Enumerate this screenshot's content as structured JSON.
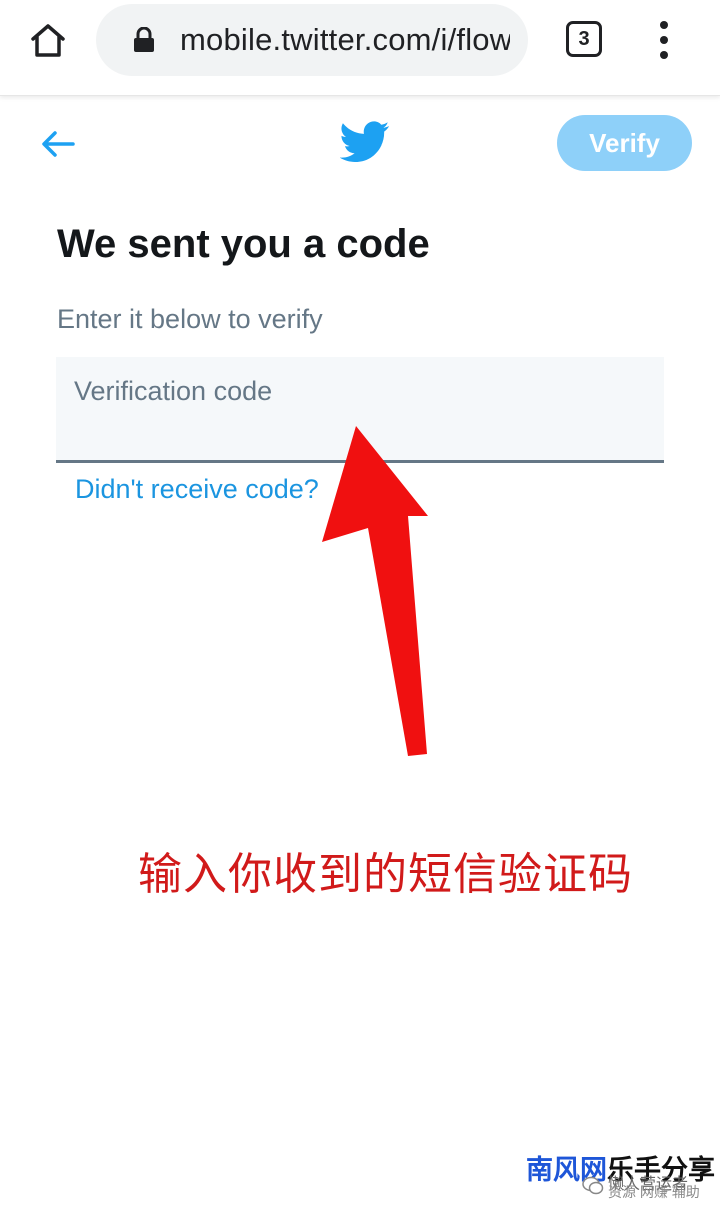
{
  "browser": {
    "url": "mobile.twitter.com/i/flow/login",
    "tab_count": "3"
  },
  "header": {
    "verify_label": "Verify"
  },
  "content": {
    "title": "We sent you a code",
    "subtitle": "Enter it below to verify",
    "code_placeholder": "Verification code",
    "resend_link": "Didn't receive code?"
  },
  "annotation": {
    "text": "输入你收到的短信验证码"
  },
  "watermark": {
    "brand_blue": "南风网",
    "brand_black": "乐手分享",
    "line": "懒人营运者",
    "sub": "资源 网赚 辅助"
  },
  "colors": {
    "twitter_blue": "#1da1f2",
    "verify_disabled": "#8ed0f9",
    "annotation_red": "#d11a1a"
  },
  "icons": {
    "home": "home-icon",
    "lock": "lock-icon",
    "menu": "more-vert-icon",
    "back": "arrow-left-icon",
    "logo": "twitter-bird-icon"
  }
}
